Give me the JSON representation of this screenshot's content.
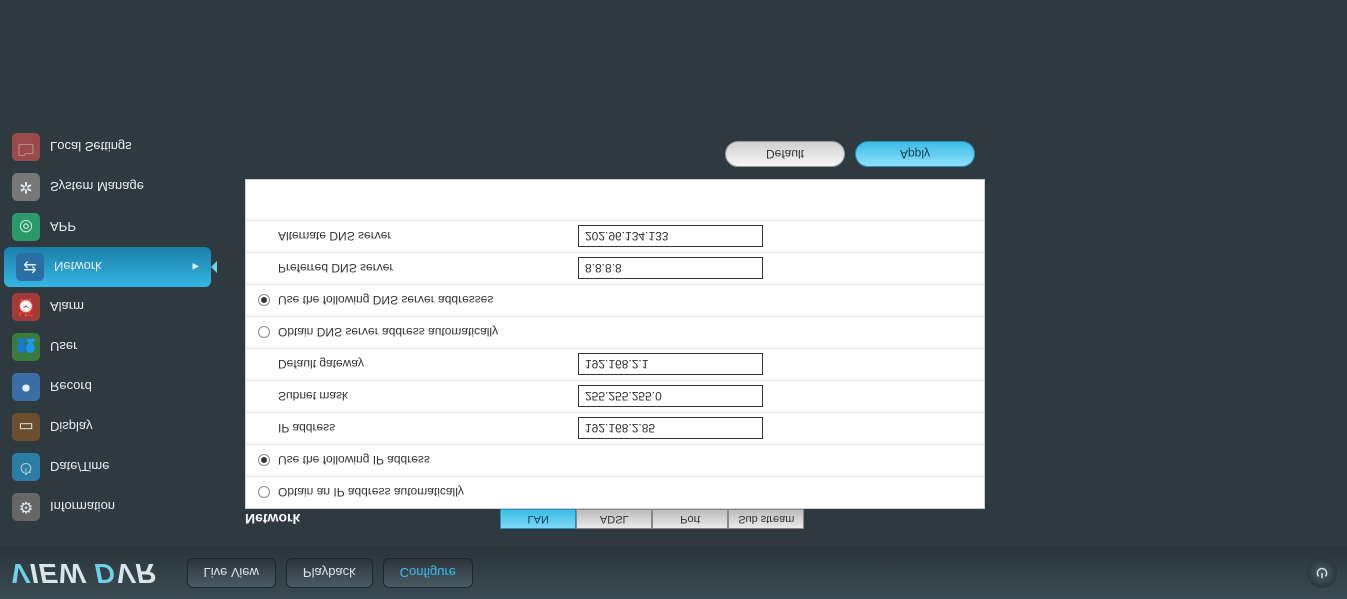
{
  "logo": {
    "v": "V",
    "rest1": "IEW",
    "space": " ",
    "d": "D",
    "rest2": "VR"
  },
  "mainnav": {
    "live": "Live View",
    "playback": "Playback",
    "configure": "Configure"
  },
  "sidebar": {
    "items": [
      {
        "label": "Information",
        "icon": "⚙"
      },
      {
        "label": "Date/Time",
        "icon": "⏱"
      },
      {
        "label": "Display",
        "icon": "▭"
      },
      {
        "label": "Record",
        "icon": "⏺"
      },
      {
        "label": "User",
        "icon": "👥"
      },
      {
        "label": "Alarm",
        "icon": "⏰"
      },
      {
        "label": "Network",
        "icon": "⇄"
      },
      {
        "label": "APP",
        "icon": "◎"
      },
      {
        "label": "System Manage",
        "icon": "✲"
      },
      {
        "label": "Local Settings",
        "icon": "🗀"
      }
    ],
    "arrow": "▸"
  },
  "panel": {
    "title": "Network",
    "tabs": {
      "lan": "LAN",
      "adsl": "ADSL",
      "port": "Port",
      "sub": "Sub stream"
    },
    "rows": {
      "obtain_ip": "Obtain an IP address automatically",
      "use_ip": "Use the following IP address",
      "ip_label": "IP address",
      "ip_value": "192.168.2.85",
      "subnet_label": "Subnet mask",
      "subnet_value": "255.255.255.0",
      "gateway_label": "Default gateway",
      "gateway_value": "192.168.2.1",
      "obtain_dns": "Obtain DNS server address automatically",
      "use_dns": "Use the following DNS server addresses",
      "pref_dns_label": "Preferred DNS server",
      "pref_dns_value": "8.8.8.8",
      "alt_dns_label": "Alternate DNS server",
      "alt_dns_value": "202.96.134.133"
    },
    "buttons": {
      "default": "Default",
      "apply": "Apply"
    }
  }
}
